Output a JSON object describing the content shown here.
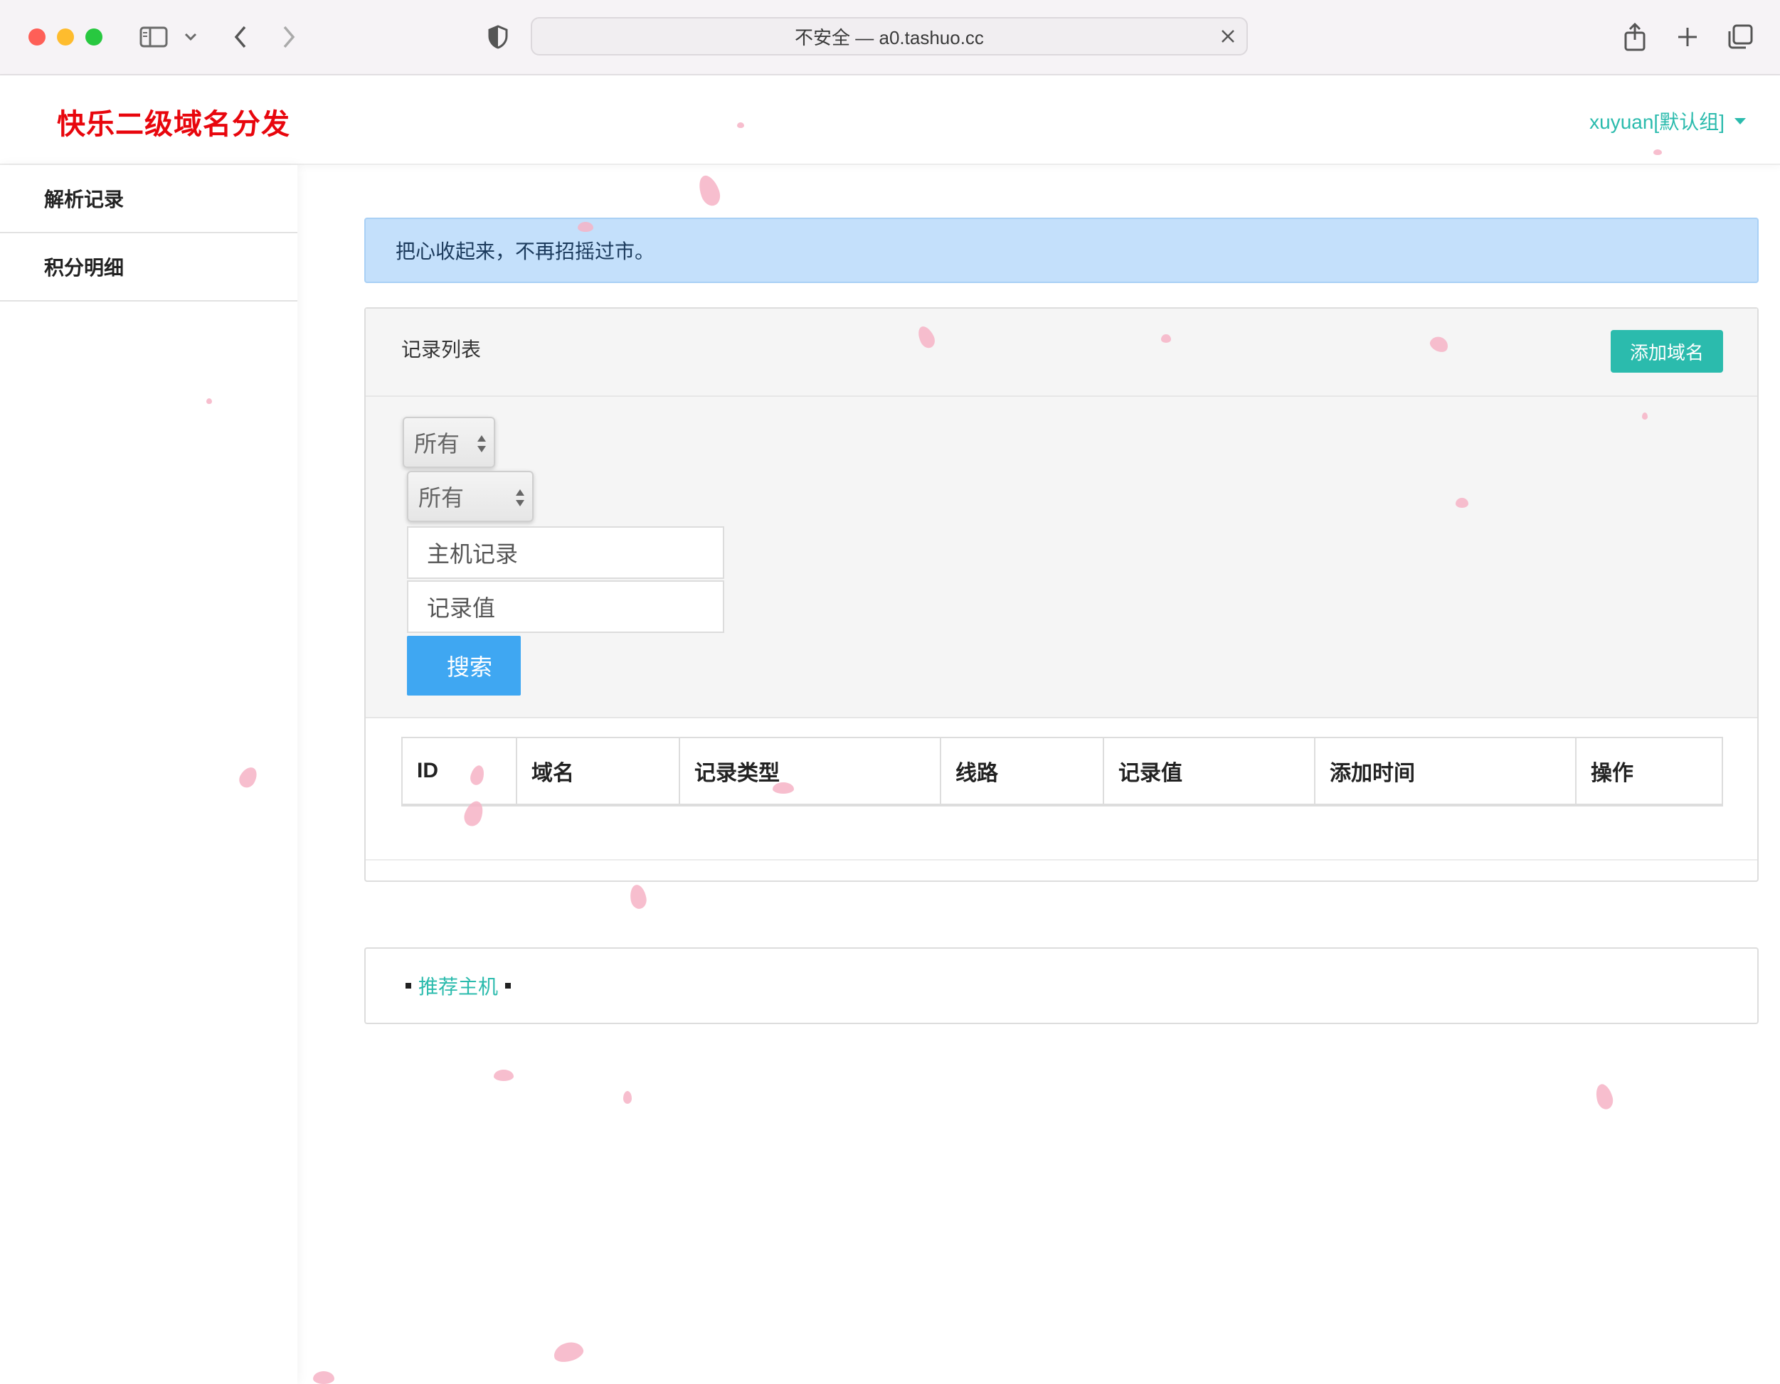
{
  "browser": {
    "address_text": "不安全 — a0.tashuo.cc"
  },
  "header": {
    "brand": "快乐二级域名分发",
    "user_label": "xuyuan[默认组]"
  },
  "sidebar": {
    "items": [
      {
        "label": "解析记录"
      },
      {
        "label": "积分明细"
      }
    ]
  },
  "alert": {
    "message": "把心收起来，不再招摇过市。"
  },
  "records_panel": {
    "title": "记录列表",
    "add_button": "添加域名",
    "filters": {
      "select_1": "所有",
      "select_2": "所有",
      "host_placeholder": "主机记录",
      "value_placeholder": "记录值",
      "search_button": "搜索"
    },
    "table": {
      "columns": [
        "ID",
        "域名",
        "记录类型",
        "线路",
        "记录值",
        "添加时间",
        "操作"
      ],
      "rows": []
    }
  },
  "footer": {
    "link_text": "推荐主机"
  },
  "colors": {
    "brand": "#e8060d",
    "accent": "#2bbbad",
    "search_button": "#3fa7f2",
    "alert_bg": "#c4e0fb"
  }
}
